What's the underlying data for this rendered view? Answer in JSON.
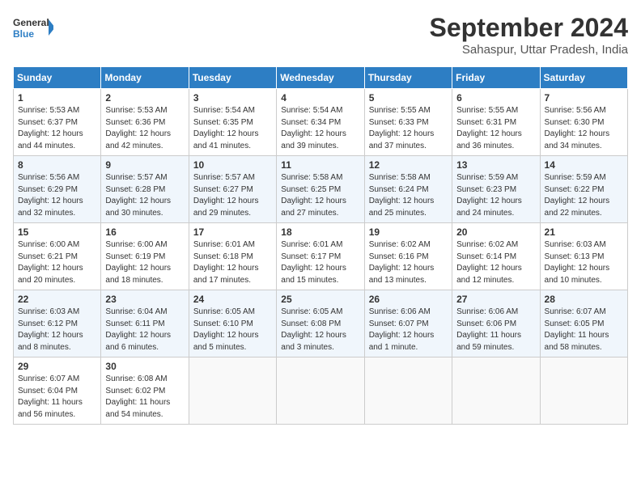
{
  "header": {
    "logo_line1": "General",
    "logo_line2": "Blue",
    "month_title": "September 2024",
    "subtitle": "Sahaspur, Uttar Pradesh, India"
  },
  "days_of_week": [
    "Sunday",
    "Monday",
    "Tuesday",
    "Wednesday",
    "Thursday",
    "Friday",
    "Saturday"
  ],
  "weeks": [
    [
      {
        "day": "1",
        "sunrise": "5:53 AM",
        "sunset": "6:37 PM",
        "daylight": "12 hours and 44 minutes."
      },
      {
        "day": "2",
        "sunrise": "5:53 AM",
        "sunset": "6:36 PM",
        "daylight": "12 hours and 42 minutes."
      },
      {
        "day": "3",
        "sunrise": "5:54 AM",
        "sunset": "6:35 PM",
        "daylight": "12 hours and 41 minutes."
      },
      {
        "day": "4",
        "sunrise": "5:54 AM",
        "sunset": "6:34 PM",
        "daylight": "12 hours and 39 minutes."
      },
      {
        "day": "5",
        "sunrise": "5:55 AM",
        "sunset": "6:33 PM",
        "daylight": "12 hours and 37 minutes."
      },
      {
        "day": "6",
        "sunrise": "5:55 AM",
        "sunset": "6:31 PM",
        "daylight": "12 hours and 36 minutes."
      },
      {
        "day": "7",
        "sunrise": "5:56 AM",
        "sunset": "6:30 PM",
        "daylight": "12 hours and 34 minutes."
      }
    ],
    [
      {
        "day": "8",
        "sunrise": "5:56 AM",
        "sunset": "6:29 PM",
        "daylight": "12 hours and 32 minutes."
      },
      {
        "day": "9",
        "sunrise": "5:57 AM",
        "sunset": "6:28 PM",
        "daylight": "12 hours and 30 minutes."
      },
      {
        "day": "10",
        "sunrise": "5:57 AM",
        "sunset": "6:27 PM",
        "daylight": "12 hours and 29 minutes."
      },
      {
        "day": "11",
        "sunrise": "5:58 AM",
        "sunset": "6:25 PM",
        "daylight": "12 hours and 27 minutes."
      },
      {
        "day": "12",
        "sunrise": "5:58 AM",
        "sunset": "6:24 PM",
        "daylight": "12 hours and 25 minutes."
      },
      {
        "day": "13",
        "sunrise": "5:59 AM",
        "sunset": "6:23 PM",
        "daylight": "12 hours and 24 minutes."
      },
      {
        "day": "14",
        "sunrise": "5:59 AM",
        "sunset": "6:22 PM",
        "daylight": "12 hours and 22 minutes."
      }
    ],
    [
      {
        "day": "15",
        "sunrise": "6:00 AM",
        "sunset": "6:21 PM",
        "daylight": "12 hours and 20 minutes."
      },
      {
        "day": "16",
        "sunrise": "6:00 AM",
        "sunset": "6:19 PM",
        "daylight": "12 hours and 18 minutes."
      },
      {
        "day": "17",
        "sunrise": "6:01 AM",
        "sunset": "6:18 PM",
        "daylight": "12 hours and 17 minutes."
      },
      {
        "day": "18",
        "sunrise": "6:01 AM",
        "sunset": "6:17 PM",
        "daylight": "12 hours and 15 minutes."
      },
      {
        "day": "19",
        "sunrise": "6:02 AM",
        "sunset": "6:16 PM",
        "daylight": "12 hours and 13 minutes."
      },
      {
        "day": "20",
        "sunrise": "6:02 AM",
        "sunset": "6:14 PM",
        "daylight": "12 hours and 12 minutes."
      },
      {
        "day": "21",
        "sunrise": "6:03 AM",
        "sunset": "6:13 PM",
        "daylight": "12 hours and 10 minutes."
      }
    ],
    [
      {
        "day": "22",
        "sunrise": "6:03 AM",
        "sunset": "6:12 PM",
        "daylight": "12 hours and 8 minutes."
      },
      {
        "day": "23",
        "sunrise": "6:04 AM",
        "sunset": "6:11 PM",
        "daylight": "12 hours and 6 minutes."
      },
      {
        "day": "24",
        "sunrise": "6:05 AM",
        "sunset": "6:10 PM",
        "daylight": "12 hours and 5 minutes."
      },
      {
        "day": "25",
        "sunrise": "6:05 AM",
        "sunset": "6:08 PM",
        "daylight": "12 hours and 3 minutes."
      },
      {
        "day": "26",
        "sunrise": "6:06 AM",
        "sunset": "6:07 PM",
        "daylight": "12 hours and 1 minute."
      },
      {
        "day": "27",
        "sunrise": "6:06 AM",
        "sunset": "6:06 PM",
        "daylight": "11 hours and 59 minutes."
      },
      {
        "day": "28",
        "sunrise": "6:07 AM",
        "sunset": "6:05 PM",
        "daylight": "11 hours and 58 minutes."
      }
    ],
    [
      {
        "day": "29",
        "sunrise": "6:07 AM",
        "sunset": "6:04 PM",
        "daylight": "11 hours and 56 minutes."
      },
      {
        "day": "30",
        "sunrise": "6:08 AM",
        "sunset": "6:02 PM",
        "daylight": "11 hours and 54 minutes."
      },
      null,
      null,
      null,
      null,
      null
    ]
  ]
}
